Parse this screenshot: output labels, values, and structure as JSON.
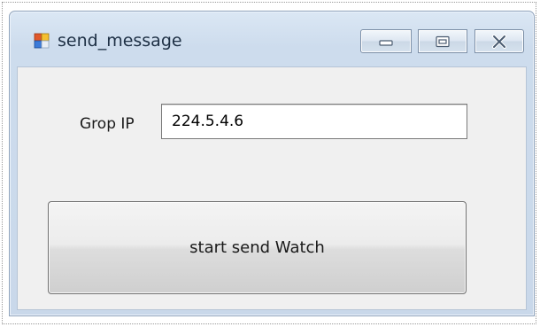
{
  "window": {
    "title": "send_message",
    "icon": "winforms-app-icon",
    "controls": {
      "minimize_icon": "minimize-icon",
      "maximize_icon": "maximize-icon",
      "close_icon": "close-icon"
    }
  },
  "form": {
    "group_ip_label": "Grop IP",
    "group_ip_value": "224.5.4.6",
    "start_button_label": "start send Watch"
  },
  "colors": {
    "title_text": "#1e3045",
    "client_background": "#f0f0f0",
    "frame": "#cddced"
  }
}
